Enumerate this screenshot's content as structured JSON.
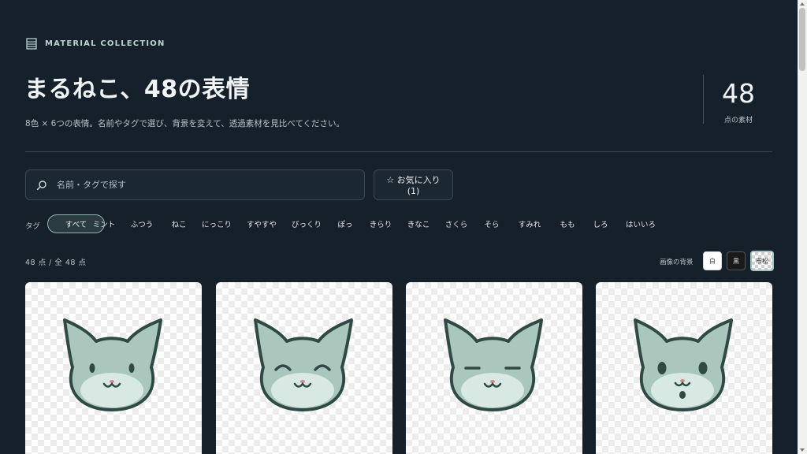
{
  "header": {
    "kicker": "MATERIAL COLLECTION",
    "title": "まるねこ、48の表情",
    "subtitle": "8色 × 6つの表情。名前やタグで選び、背景を変えて、透過素材を見比べてください。",
    "count": "48",
    "count_label": "点の素材"
  },
  "search": {
    "placeholder": "名前・タグで探す",
    "value": ""
  },
  "favorites": {
    "label": "☆ お気に入り (1)"
  },
  "tags": {
    "label": "タグ",
    "items": [
      "すべて",
      "ミント",
      "ふつう",
      "ねこ",
      "にっこり",
      "すやすや",
      "びっくり",
      "ぽっ",
      "きらり",
      "きなこ",
      "さくら",
      "そら",
      "すみれ",
      "もも",
      "しろ",
      "はいいろ"
    ],
    "active": "すべて"
  },
  "results": {
    "count_text": "48 点 / 全 48 点"
  },
  "background": {
    "label": "画像の背景",
    "options": [
      "白",
      "黒",
      "市松"
    ],
    "selected": "市松"
  },
  "cards": [
    {
      "expression": "normal",
      "color": "mint"
    },
    {
      "expression": "smile",
      "color": "mint"
    },
    {
      "expression": "sleepy",
      "color": "mint"
    },
    {
      "expression": "surprised",
      "color": "mint"
    }
  ],
  "colors": {
    "page_bg": "#16202a",
    "cat_fill": "#a9c7bc",
    "cat_outline": "#2f4a44",
    "cat_muzzle": "#d8e8e2",
    "cat_nose": "#d68a8a",
    "accent": "#8fb3ae"
  }
}
